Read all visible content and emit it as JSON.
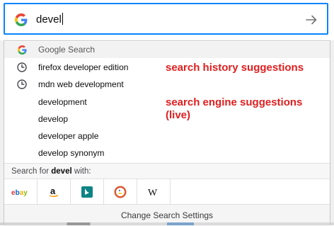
{
  "search": {
    "query": "devel",
    "engine_icon": "google-g-icon",
    "go_icon": "arrow-right-icon"
  },
  "google_row": {
    "label": "Google Search",
    "icon": "google-g-icon"
  },
  "history": [
    {
      "label": "firefox developer edition",
      "icon": "clock-icon"
    },
    {
      "label": "mdn web development",
      "icon": "clock-icon"
    }
  ],
  "suggestions": [
    {
      "label": "development"
    },
    {
      "label": "develop"
    },
    {
      "label": "developer apple"
    },
    {
      "label": "develop synonym"
    }
  ],
  "annotations": {
    "history": "search history suggestions",
    "engine_line1": "search engine suggestions",
    "engine_line2": "(live)"
  },
  "search_for": {
    "prefix": "Search for",
    "term": "devel",
    "suffix": "with:"
  },
  "engines": [
    {
      "name": "ebay",
      "label": "ebay"
    },
    {
      "name": "amazon",
      "label": "a"
    },
    {
      "name": "bing",
      "label": "b"
    },
    {
      "name": "duckduckgo",
      "label": "duckduckgo"
    },
    {
      "name": "wikipedia",
      "label": "W"
    }
  ],
  "footer": {
    "change_settings": "Change Search Settings"
  },
  "colors": {
    "focus_border": "#0a84ff",
    "annotation": "#e01e1e"
  }
}
